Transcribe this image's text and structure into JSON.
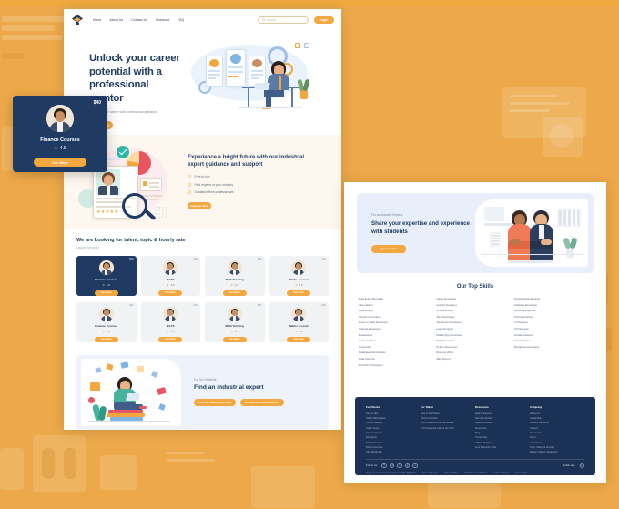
{
  "theme": {
    "orange": "#f3a73f",
    "navy": "#1f3b63",
    "page_bg": "#eda949",
    "footer_bg": "#1c3156"
  },
  "nav": {
    "logo_icon": "diamond-logo-icon",
    "links": [
      "Home",
      "About Us",
      "Contact Us",
      "Checkout",
      "FAQ"
    ],
    "search": {
      "placeholder": "Search",
      "icon": "search-icon"
    },
    "login_label": "Login"
  },
  "hero": {
    "title": "Unlock your career potential with a professional mentor",
    "subtitle": "Next into your career with professional guidance",
    "cta_label": "Get Started",
    "art_name": "woman-at-desk-with-profile-cards-illustration"
  },
  "mentor": {
    "title": "Experience a bright future with our industrial expert guidance and support",
    "items": [
      "Free to join",
      "Find experts in your industry",
      "Guidance from professionals"
    ],
    "cta_label": "Register Now",
    "art_name": "resume-profile-magnifier-illustration",
    "check_icon": "check-square-icon"
  },
  "talent": {
    "title": "We are Looking for talent, topic & hourly rate",
    "subtitle": "Looking for work?",
    "see_more_label": "See More",
    "star_icon": "star-icon",
    "cards": [
      {
        "name": "Finance Courses",
        "rating": "4.5",
        "price": "$40",
        "active": true
      },
      {
        "name": "IELTS",
        "rating": "4.5",
        "price": "$40",
        "active": false
      },
      {
        "name": "Math Tutoring",
        "rating": "4.5",
        "price": "$40",
        "active": false
      },
      {
        "name": "Maths A Level",
        "rating": "4.5",
        "price": "$40",
        "active": false
      },
      {
        "name": "Finance Courses",
        "rating": "4.5",
        "price": "$40",
        "active": false
      },
      {
        "name": "IELTS",
        "rating": "4.5",
        "price": "$40",
        "active": false
      },
      {
        "name": "Math Tutoring",
        "rating": "4.5",
        "price": "$40",
        "active": false
      },
      {
        "name": "Maths A Level",
        "rating": "4.5",
        "price": "$40",
        "active": false
      }
    ]
  },
  "students": {
    "kicker": "For Our Students",
    "title": "Find an industrial expert",
    "btn_primary": "Find the training you need",
    "btn_secondary": "Browse and attend courses",
    "art_name": "woman-reading-on-books-illustration"
  },
  "experts": {
    "kicker": "For our Industry Experts",
    "title": "Share your expertise and experience with students",
    "cta_label": "Opportunities",
    "art_name": "two-professionals-back-to-back-illustration"
  },
  "skills": {
    "title": "Our Top Skills",
    "columns": [
      [
        "Data Entry Specialist",
        "Video Editor",
        "Data Analyst",
        "Shopify Developer",
        "Ruby on Rails Developer",
        "Android Developer",
        "Bookkeeper",
        "Content Writer",
        "Copywriter",
        "Database Administrator",
        "Data Scientist",
        "Front End Developer"
      ],
      [
        "Game Developer",
        "Graphic Designer",
        "iOS Developer",
        "Java Developer",
        "JavaScript Developer",
        "Logo Designer",
        "Mobile App Developer",
        "PHP Developer",
        "Python Developer",
        "Resume Writer",
        "SEO Expert"
      ],
      [
        "Social Media Manager",
        "Software Developer",
        "Software Engineer",
        "Technical Writer",
        "UI Designer",
        "UX Designer",
        "Virtual Assistant",
        "Web Designer",
        "Wordpress Developer"
      ]
    ]
  },
  "footer": {
    "columns": [
      {
        "head": "For Clients",
        "links": [
          "How to Hire",
          "Talent Marketplace",
          "Project Catalog",
          "Talent Scout",
          "Hire an Agency",
          "Enterprise",
          "Payroll Services",
          "Direct Contracts",
          "Hire Worldwide"
        ]
      },
      {
        "head": "For Talent",
        "links": [
          "How to Find Work",
          "Direct Contracts",
          "Find Freelance Jobs Worldwide",
          "Find Freelance Jobs in the USA"
        ]
      },
      {
        "head": "Resources",
        "links": [
          "Help & Support",
          "Success Stories",
          "Upwork Reviews",
          "Resources",
          "Blog",
          "Community",
          "Affiliate Program",
          "Free Business Tools"
        ]
      },
      {
        "head": "Company",
        "links": [
          "About Us",
          "Leadership",
          "Investor Relations",
          "Careers",
          "Our Impact",
          "Press",
          "Contact Us",
          "Trust, Safety & Security",
          "Modern Slavery Statement"
        ]
      }
    ],
    "follow_label": "Follow Us",
    "social": [
      "f",
      "in",
      "t",
      "y",
      "i"
    ],
    "mobile_label": "Mobile app",
    "mobile_icon": "apple-icon",
    "legal": [
      "Designed and Developed by Powered By WORK ID",
      "Terms of Service",
      "Privacy Policy",
      "CA Notice at Collection",
      "Cookie Settings",
      "Accessibility"
    ]
  }
}
